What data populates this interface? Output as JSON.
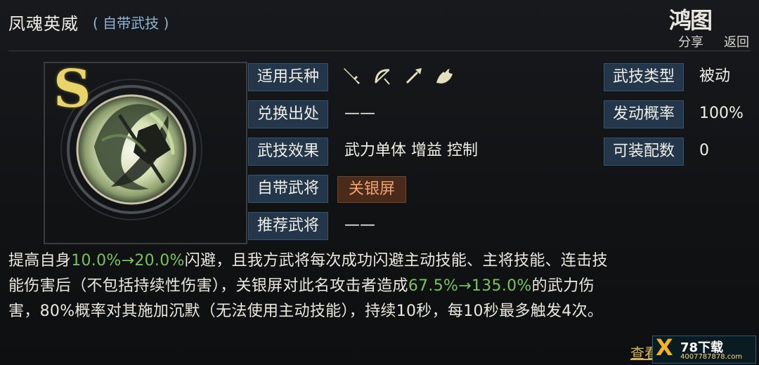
{
  "header": {
    "title": "凤魂英威",
    "subtitle": "( 自带武技 )",
    "logo": "鸿图",
    "share": "分享",
    "back": "返回"
  },
  "skill": {
    "grade": "S"
  },
  "left_fields": [
    {
      "label": "适用兵种",
      "value": ""
    },
    {
      "label": "兑换出处",
      "value": "——"
    },
    {
      "label": "武技效果",
      "value": "武力单体 增益 控制"
    },
    {
      "label": "自带武将",
      "value": "关银屏"
    },
    {
      "label": "推荐武将",
      "value": "——"
    }
  ],
  "right_fields": [
    {
      "label": "武技类型",
      "value": "被动"
    },
    {
      "label": "发动概率",
      "value": "100%"
    },
    {
      "label": "可装配数",
      "value": "0"
    }
  ],
  "weapon_icons": [
    "sword-icon",
    "bow-icon",
    "spear-icon",
    "horse-icon"
  ],
  "description": {
    "line1_a": "提高自身",
    "line1_b": "10.0%→20.0%",
    "line1_c": "闪避，且我方武将每次成功闪避主动技能、主将技能、连击技",
    "line2_a": "能伤害后（不包括持续性伤害），关银屏对此名攻击者造成",
    "line2_b": "67.5%→135.0%",
    "line2_c": "的武力伤",
    "line3": "害，80%概率对其施加沉默（无法使用主动技能），持续10秒，每10秒最多触发4次。"
  },
  "more_link": "查看",
  "watermark": {
    "logo": "X",
    "text": "78下载",
    "url": "4007787878.com"
  }
}
